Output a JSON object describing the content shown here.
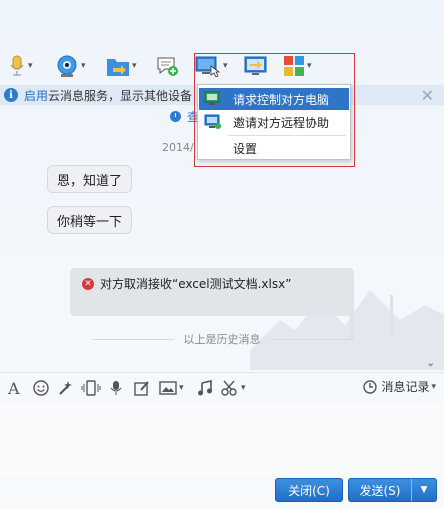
{
  "toolbar": {
    "items": [
      {
        "name": "voice-call",
        "icon": "microphone-icon"
      },
      {
        "name": "video-call",
        "icon": "webcam-icon"
      },
      {
        "name": "send-file",
        "icon": "folder-send-icon"
      },
      {
        "name": "create-discussion",
        "icon": "chat-add-icon"
      },
      {
        "name": "remote-desktop",
        "icon": "remote-desktop-icon"
      },
      {
        "name": "share-screen",
        "icon": "screen-share-icon"
      },
      {
        "name": "apps",
        "icon": "apps-grid-icon"
      }
    ]
  },
  "infobar": {
    "link_text": "启用",
    "text": "云消息服务，显示其他设备"
  },
  "history_top": {
    "text": "查"
  },
  "date": "2014/",
  "remote_menu": {
    "items": [
      {
        "label": "请求控制对方电脑",
        "selected": true
      },
      {
        "label": "邀请对方远程协助",
        "selected": false
      },
      {
        "label": "设置",
        "selected": false
      }
    ]
  },
  "messages": [
    {
      "text": "恩，知道了"
    },
    {
      "text": "你稍等一下"
    }
  ],
  "notice": {
    "text": "对方取消接收“excel测试文档.xlsx”"
  },
  "history_divider": "以上是历史消息",
  "message_record": "消息记录",
  "buttons": {
    "close": "关闭(C)",
    "send": "发送(S)"
  },
  "colors": {
    "accent": "#2f75c7",
    "highlight_border": "#d23b3b",
    "error": "#d9383a"
  }
}
